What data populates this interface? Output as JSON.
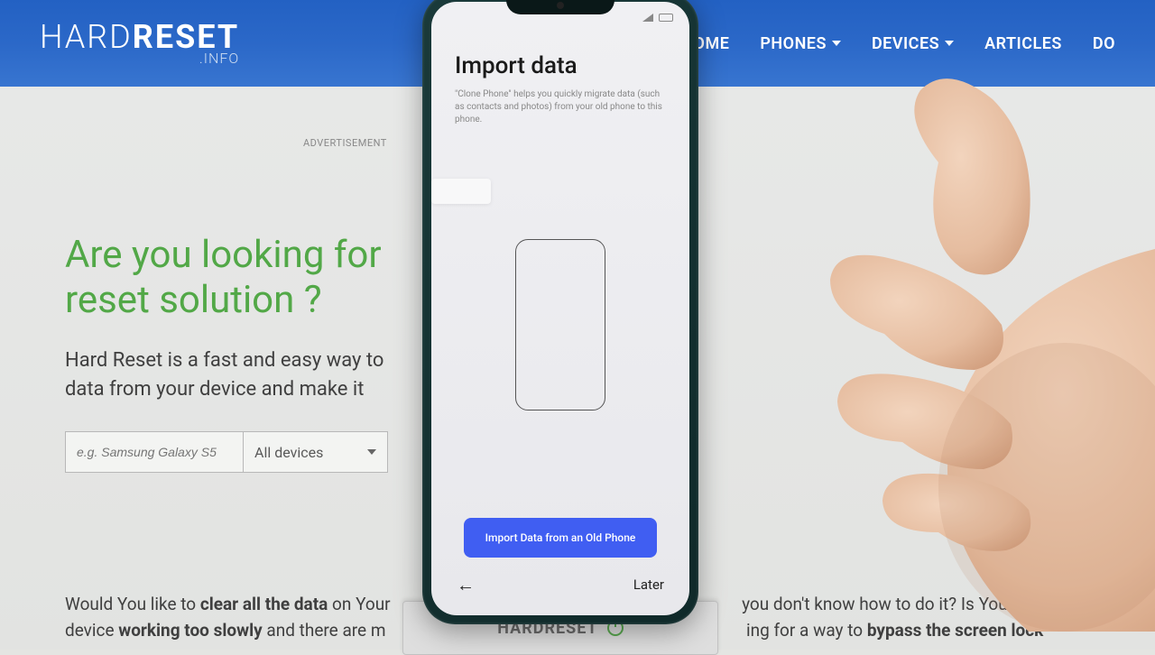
{
  "site": {
    "logo_main": "HARD",
    "logo_bold": "RESET",
    "logo_sub": ".INFO",
    "nav": {
      "home": "HOME",
      "phones": "PHONES",
      "devices": "DEVICES",
      "articles": "ARTICLES",
      "last": "DO"
    },
    "ad_label": "ADVERTISEMENT",
    "headline_l1": "Are you looking for",
    "headline_l2": "reset solution ?",
    "subtext_l1": "Hard Reset is a fast and easy way to",
    "subtext_l2": "data from your device and make it",
    "search_placeholder": "e.g. Samsung Galaxy S5",
    "device_select": "All devices",
    "body_pre": "Would You like to ",
    "body_b1": "clear all the data",
    "body_mid1": " on Your",
    "body_mid2": "you don't know how to do it? Is Your device ",
    "body_b2": "working too slowly",
    "body_mid3": " and there are m",
    "body_mid4": "ing for a way to ",
    "body_b3": "bypass the screen lock",
    "stand_label": "HARDRESET"
  },
  "phone": {
    "title": "Import data",
    "description": "\"Clone Phone\" helps you quickly migrate data (such as contacts and photos) from your old phone to this phone.",
    "primary_button": "Import Data from an Old Phone",
    "back_icon": "←",
    "later": "Later"
  }
}
